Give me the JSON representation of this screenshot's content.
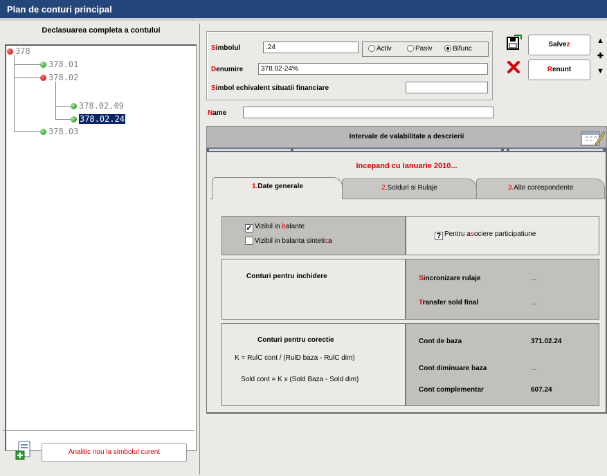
{
  "window": {
    "title": "Plan de conturi principal"
  },
  "tree": {
    "title": "Declasuarea completa a contului",
    "nodes": [
      "378",
      "378.01",
      "378.02",
      "378.02.09",
      "378.02.24",
      "378.03"
    ],
    "selected": "378.02.24"
  },
  "left_bottom": {
    "button_label": "Analitic nou la simbolul curent"
  },
  "form": {
    "simbol_label_hot": "S",
    "simbol_label_rest": "imbolul",
    "simbol_value": ".24",
    "radio_activ": "Activ",
    "radio_pasiv": "Pasiv",
    "radio_bifunc": "Bifunc",
    "radio_selected": "Bifunc",
    "denumire_label_hot": "D",
    "denumire_label_rest": "enumire",
    "denumire_value": "378.02-24%",
    "simbol_echiv_label_hot": "S",
    "simbol_echiv_label_rest": "imbol echivalent situatii financiare",
    "simbol_echiv_value": "",
    "name_label_hot": "N",
    "name_label_rest": "ame",
    "name_value": ""
  },
  "actions": {
    "save_pre": "Salve",
    "save_hot": "z",
    "cancel_hot": "R",
    "cancel_rest": "enunt"
  },
  "intervals": {
    "header": "Intervale de valabilitate a descrierii",
    "since": "Incepand cu Ianuarie 2010..."
  },
  "tabs": [
    {
      "num": "1.",
      "label": "Date generale"
    },
    {
      "num": "2.",
      "label": "Solduri si Rulaje"
    },
    {
      "num": "3.",
      "label": "Alte corespondente"
    }
  ],
  "general": {
    "vizibil_balante_pre": "Vizibil in ",
    "vizibil_balante_hot": "b",
    "vizibil_balante_post": "alante",
    "vizibil_balante_checked": true,
    "vizibil_sintetica_pre": "Vizibil in balanta sinteti",
    "vizibil_sintetica_hot": "c",
    "vizibil_sintetica_post": "a",
    "vizibil_sintetica_checked": false,
    "asociere_pre": "Pentru a",
    "asociere_hot": "s",
    "asociere_post": "ociere participatiune",
    "asociere_checked": false,
    "asociere_mark": "?",
    "inchidere_title": "Conturi pentru inchidere",
    "sincronizare_hot": "S",
    "sincronizare_rest": "incronizare rulaje",
    "sincronizare_value": "...",
    "transfer_hot": "T",
    "transfer_rest": "ransfer sold final",
    "transfer_value": "...",
    "corectie_title": "Conturi pentru corectie",
    "formula_k": "K = RulC cont / (RulD baza - RulC dim)",
    "formula_sold": "Sold cont = K x (Sold Baza - Sold dim)",
    "cont_baza_label": "Cont de baza",
    "cont_baza_value": "371.02.24",
    "cont_dim_label": "Cont diminuare baza",
    "cont_dim_value": "...",
    "cont_compl_label": "Cont complementar",
    "cont_compl_value": "607.24"
  }
}
